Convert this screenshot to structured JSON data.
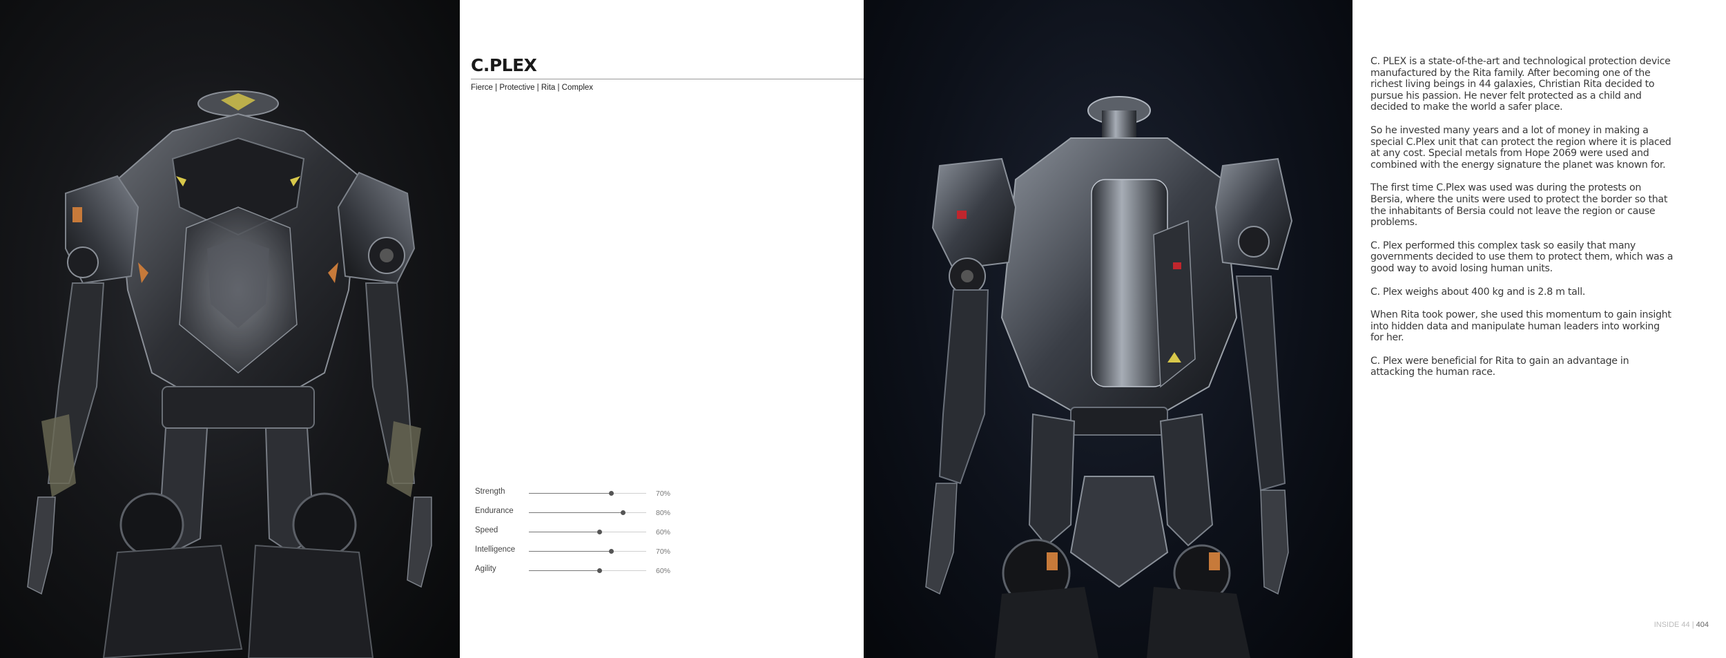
{
  "character": {
    "name": "C.PLEX",
    "tags": "Fierce | Protective | Rita | Complex"
  },
  "stats": [
    {
      "label": "Strength",
      "value": 70,
      "display": "70%"
    },
    {
      "label": "Endurance",
      "value": 80,
      "display": "80%"
    },
    {
      "label": "Speed",
      "value": 60,
      "display": "60%"
    },
    {
      "label": "Intelligence",
      "value": 70,
      "display": "70%"
    },
    {
      "label": "Agility",
      "value": 60,
      "display": "60%"
    }
  ],
  "paragraphs": [
    "C. PLEX is a state-of-the-art and technological protection device manufactured by the Rita family. After becoming one of the richest living beings in 44 galaxies, Christian Rita decided to pursue his passion. He never felt protected as a child and decided to make the world a safer place.",
    "So he invested many years and a lot of money in making a special C.Plex unit that can protect the region where it is placed at any cost. Special metals from Hope 2069 were used and combined with the energy signature the planet was known for.",
    "The first time C.Plex was used was during the protests on Bersia, where the units were used to protect the border so that the inhabitants of Bersia could not leave the region or cause problems.",
    "C. Plex performed this complex task so easily that many governments decided to use them to protect them, which was a good way to avoid losing human units.",
    "C. Plex weighs about 400 kg and is 2.8 m tall.",
    "When Rita took power, she used this momentum to gain insight into hidden data and manipulate human leaders into working for her.",
    "C. Plex were beneficial for Rita to gain an advantage in attacking the human race."
  ],
  "footer": {
    "book": "INSIDE 44 |",
    "page": "404"
  },
  "colors": {
    "robot_metal": "#3c3f45",
    "robot_highlight": "#9aa0a8",
    "accent_orange": "#c77a3a",
    "accent_red": "#c0262d",
    "accent_yellow": "#d8c84a"
  }
}
